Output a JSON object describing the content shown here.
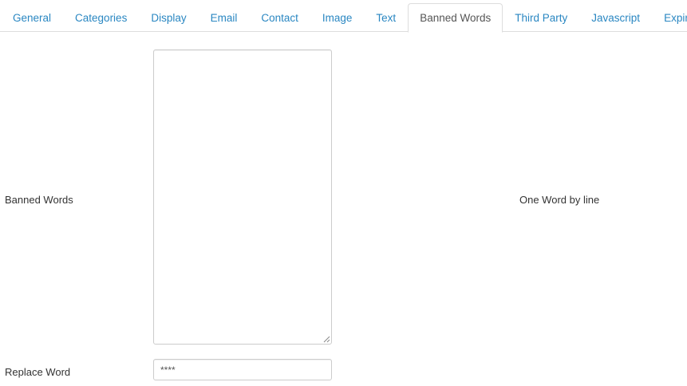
{
  "tabs": [
    {
      "label": "General",
      "active": false
    },
    {
      "label": "Categories",
      "active": false
    },
    {
      "label": "Display",
      "active": false
    },
    {
      "label": "Email",
      "active": false
    },
    {
      "label": "Contact",
      "active": false
    },
    {
      "label": "Image",
      "active": false
    },
    {
      "label": "Text",
      "active": false
    },
    {
      "label": "Banned Words",
      "active": true
    },
    {
      "label": "Third Party",
      "active": false
    },
    {
      "label": "Javascript",
      "active": false
    },
    {
      "label": "Expiration",
      "active": false
    }
  ],
  "form": {
    "banned_words": {
      "label": "Banned Words",
      "value": "",
      "hint": "One Word by line"
    },
    "replace_word": {
      "label": "Replace Word",
      "value": "****"
    }
  },
  "colors": {
    "tab_link": "#2a87c2",
    "tab_active_text": "#555555",
    "border": "#dddddd",
    "input_border": "#cccccc"
  }
}
